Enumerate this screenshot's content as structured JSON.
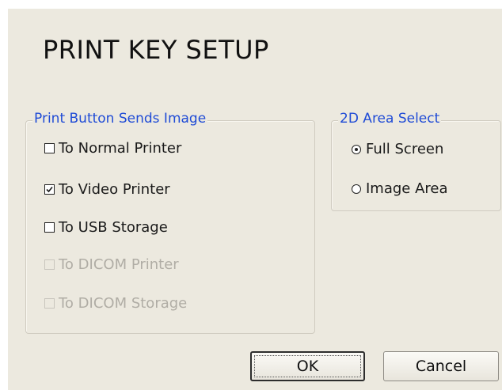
{
  "dialog": {
    "title": "PRINT KEY SETUP"
  },
  "print_group": {
    "label": "Print Button Sends Image",
    "options": [
      {
        "label": "To Normal Printer",
        "checked": false,
        "enabled": true
      },
      {
        "label": "To Video Printer",
        "checked": true,
        "enabled": true
      },
      {
        "label": "To USB Storage",
        "checked": false,
        "enabled": true
      },
      {
        "label": "To DICOM Printer",
        "checked": false,
        "enabled": false
      },
      {
        "label": "To DICOM Storage",
        "checked": false,
        "enabled": false
      }
    ]
  },
  "area_group": {
    "label": "2D Area Select",
    "options": [
      {
        "label": "Full Screen",
        "selected": true
      },
      {
        "label": "Image Area",
        "selected": false
      }
    ]
  },
  "buttons": {
    "ok": "OK",
    "cancel": "Cancel"
  },
  "colors": {
    "background": "#ece9df",
    "group_label": "#1f4bd6",
    "disabled_text": "#b0ada5"
  }
}
